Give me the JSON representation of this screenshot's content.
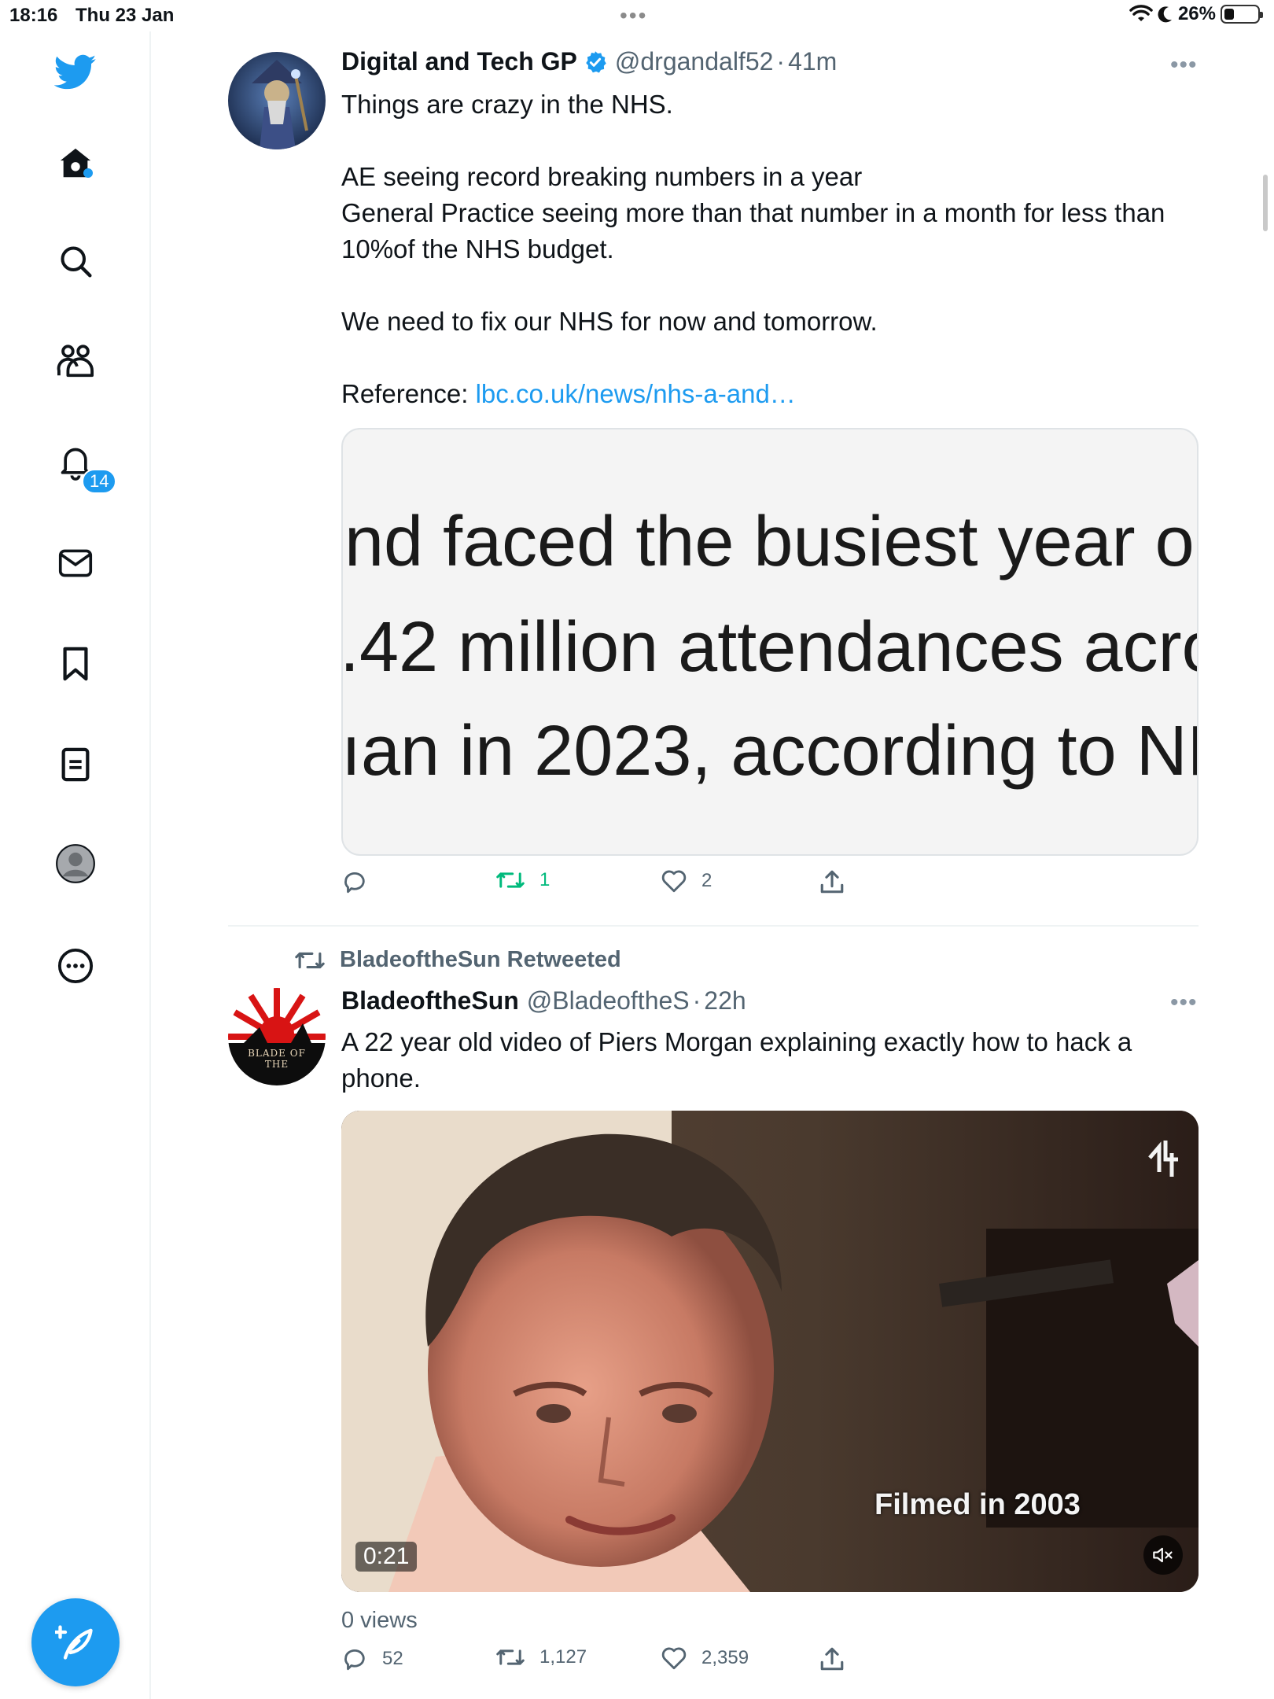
{
  "status_bar": {
    "time": "18:16",
    "date": "Thu 23 Jan",
    "battery": "26%"
  },
  "sidebar": {
    "items": [
      {
        "icon": "twitter-bird-icon"
      },
      {
        "icon": "home-icon"
      },
      {
        "icon": "search-icon"
      },
      {
        "icon": "communities-icon"
      },
      {
        "icon": "notifications-icon",
        "badge": "14"
      },
      {
        "icon": "messages-icon"
      },
      {
        "icon": "bookmarks-icon"
      },
      {
        "icon": "lists-icon"
      },
      {
        "icon": "profile-icon"
      },
      {
        "icon": "more-icon"
      }
    ],
    "notification_count": "14"
  },
  "colors": {
    "accent": "#1d9bf0",
    "retweet_green": "#00ba7c",
    "secondary_text": "#536471"
  },
  "tweets": [
    {
      "display_name": "Digital and Tech GP",
      "verified": true,
      "handle": "@drgandalf52",
      "time": "41m",
      "text": "Things are crazy in the NHS.\n\nAE seeing record breaking numbers in a year\nGeneral Practice seeing more than that number in a month for less than 10%of the NHS budget.\n\nWe need to fix our NHS for now and tomorrow.\n\n",
      "reference_label": "Reference: ",
      "reference_link": "lbc.co.uk/news/nhs-a-and…",
      "card_lines": [
        "nd faced the busiest year or",
        ".42 million attendances acro",
        "ıan in 2023, according to NH"
      ],
      "replies": "",
      "retweets": "1",
      "likes": "2"
    },
    {
      "retweeted_by": "BladeoftheSun Retweeted",
      "display_name": "BladeoftheSun",
      "verified": false,
      "handle": "@BladeoftheS",
      "time": "22h",
      "text": "A 22 year old video of Piers Morgan explaining exactly how to hack a phone.",
      "video_caption": "Filmed in 2003",
      "video_duration": "0:21",
      "views": "0 views",
      "replies": "52",
      "retweets": "1,127",
      "likes": "2,359",
      "avatar_text": "BLADE OF THE"
    }
  ]
}
